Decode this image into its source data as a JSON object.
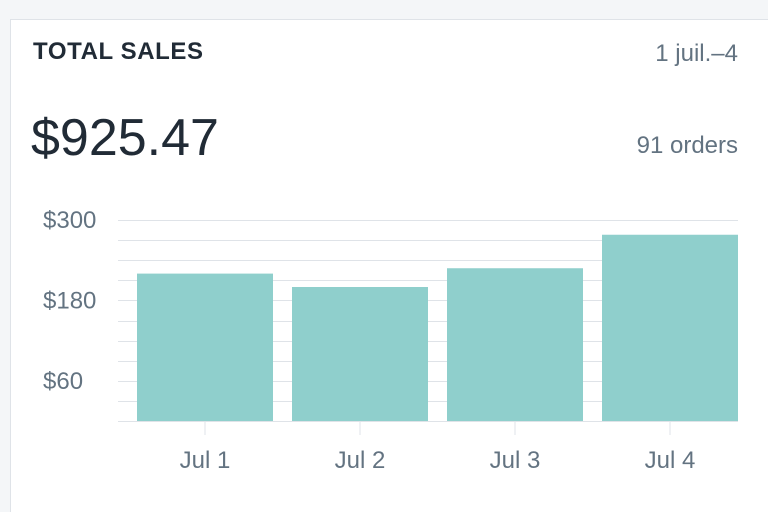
{
  "card": {
    "title": "TOTAL SALES",
    "date_range": "1 juil.–4",
    "total": "$925.47",
    "orders": "91 orders"
  },
  "colors": {
    "bar": "#8fcfcc",
    "grid": "#dfe3e8",
    "text": "#637381",
    "heading": "#212b36"
  },
  "chart_data": {
    "type": "bar",
    "title": "",
    "xlabel": "",
    "ylabel": "",
    "categories": [
      "Jul 1",
      "Jul 2",
      "Jul 3",
      "Jul 4"
    ],
    "values": [
      220,
      200,
      228,
      278
    ],
    "ylim": [
      0,
      300
    ],
    "yticks": [
      60,
      180,
      300
    ],
    "ytick_labels": [
      "$60",
      "$180",
      "$300"
    ],
    "grid": true,
    "legend": "none"
  }
}
